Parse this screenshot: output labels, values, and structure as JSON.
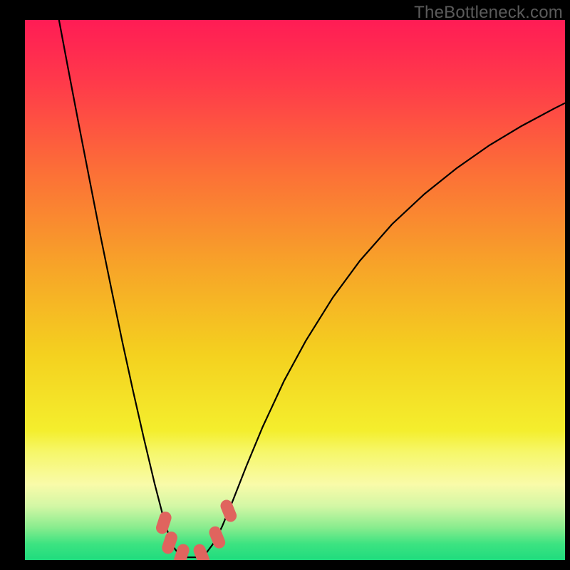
{
  "watermark": "TheBottleneck.com",
  "chart_data": {
    "type": "line",
    "title": "",
    "xlabel": "",
    "ylabel": "",
    "xlim": [
      0,
      100
    ],
    "ylim": [
      0,
      100
    ],
    "grid": false,
    "legend": false,
    "background": {
      "type": "vertical-gradient",
      "stops": [
        {
          "pos": 0.0,
          "color": "#ff1c55"
        },
        {
          "pos": 0.12,
          "color": "#ff3b4a"
        },
        {
          "pos": 0.28,
          "color": "#fc6f37"
        },
        {
          "pos": 0.46,
          "color": "#f7a528"
        },
        {
          "pos": 0.62,
          "color": "#f4d11f"
        },
        {
          "pos": 0.76,
          "color": "#f4ee2d"
        },
        {
          "pos": 0.8,
          "color": "#f6f76a"
        },
        {
          "pos": 0.86,
          "color": "#f9fba9"
        },
        {
          "pos": 0.9,
          "color": "#d3f7a5"
        },
        {
          "pos": 0.94,
          "color": "#88ec8e"
        },
        {
          "pos": 0.97,
          "color": "#3de381"
        },
        {
          "pos": 1.0,
          "color": "#1fdc7e"
        }
      ]
    },
    "series": [
      {
        "name": "bottleneck-curve",
        "stroke": "#000000",
        "points": [
          {
            "x": 6.3,
            "y": 100.0
          },
          {
            "x": 8.0,
            "y": 91.0
          },
          {
            "x": 10.0,
            "y": 80.5
          },
          {
            "x": 12.0,
            "y": 70.2
          },
          {
            "x": 14.0,
            "y": 60.0
          },
          {
            "x": 16.0,
            "y": 50.2
          },
          {
            "x": 18.0,
            "y": 40.6
          },
          {
            "x": 20.0,
            "y": 31.4
          },
          {
            "x": 22.0,
            "y": 22.6
          },
          {
            "x": 24.0,
            "y": 14.2
          },
          {
            "x": 25.5,
            "y": 8.4
          },
          {
            "x": 26.5,
            "y": 5.0
          },
          {
            "x": 27.5,
            "y": 2.4
          },
          {
            "x": 28.5,
            "y": 1.1
          },
          {
            "x": 30.0,
            "y": 0.5
          },
          {
            "x": 32.0,
            "y": 0.5
          },
          {
            "x": 33.5,
            "y": 1.2
          },
          {
            "x": 35.0,
            "y": 3.2
          },
          {
            "x": 36.5,
            "y": 6.2
          },
          {
            "x": 38.5,
            "y": 11.0
          },
          {
            "x": 41.0,
            "y": 17.4
          },
          {
            "x": 44.0,
            "y": 24.6
          },
          {
            "x": 48.0,
            "y": 33.2
          },
          {
            "x": 52.0,
            "y": 40.6
          },
          {
            "x": 57.0,
            "y": 48.6
          },
          {
            "x": 62.0,
            "y": 55.4
          },
          {
            "x": 68.0,
            "y": 62.2
          },
          {
            "x": 74.0,
            "y": 67.8
          },
          {
            "x": 80.0,
            "y": 72.6
          },
          {
            "x": 86.0,
            "y": 76.8
          },
          {
            "x": 92.0,
            "y": 80.4
          },
          {
            "x": 98.0,
            "y": 83.6
          },
          {
            "x": 100.0,
            "y": 84.6
          }
        ]
      }
    ],
    "markers": [
      {
        "x": 25.7,
        "y": 6.9,
        "color": "#e0645e"
      },
      {
        "x": 26.8,
        "y": 3.2,
        "color": "#e0645e"
      },
      {
        "x": 29.0,
        "y": 0.9,
        "color": "#e0645e"
      },
      {
        "x": 32.7,
        "y": 0.9,
        "color": "#e0645e"
      },
      {
        "x": 35.6,
        "y": 4.2,
        "color": "#e0645e"
      },
      {
        "x": 37.7,
        "y": 9.1,
        "color": "#e0645e"
      }
    ]
  }
}
